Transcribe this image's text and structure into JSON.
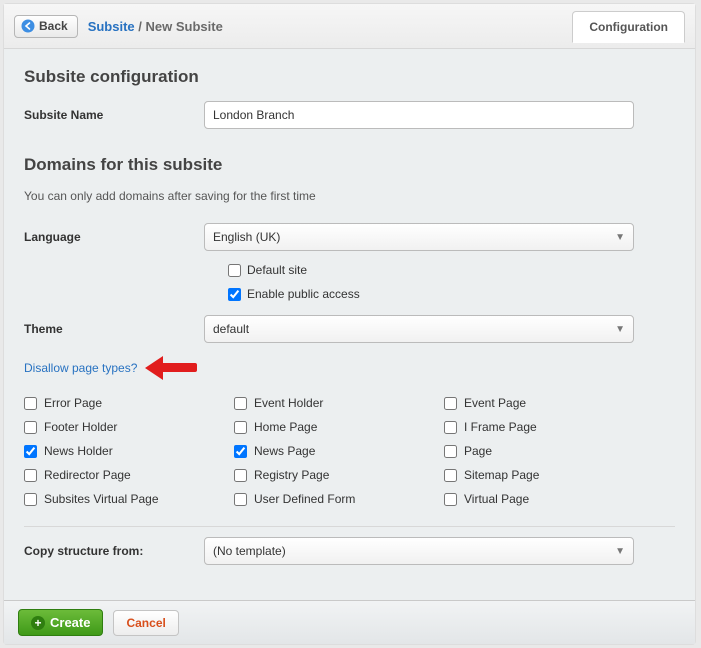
{
  "header": {
    "back_label": "Back",
    "breadcrumb_link": "Subsite",
    "breadcrumb_current": "New Subsite",
    "tab_label": "Configuration"
  },
  "section_config": {
    "title": "Subsite configuration",
    "subsite_name_label": "Subsite Name",
    "subsite_name_value": "London Branch"
  },
  "section_domains": {
    "title": "Domains for this subsite",
    "note": "You can only add domains after saving for the first time",
    "language_label": "Language",
    "language_value": "English (UK)",
    "default_site_label": "Default site",
    "default_site_checked": false,
    "public_access_label": "Enable public access",
    "public_access_checked": true,
    "theme_label": "Theme",
    "theme_value": "default",
    "disallow_link": "Disallow page types?"
  },
  "page_types": [
    {
      "label": "Error Page",
      "checked": false
    },
    {
      "label": "Event Holder",
      "checked": false
    },
    {
      "label": "Event Page",
      "checked": false
    },
    {
      "label": "Footer Holder",
      "checked": false
    },
    {
      "label": "Home Page",
      "checked": false
    },
    {
      "label": "I Frame Page",
      "checked": false
    },
    {
      "label": "News Holder",
      "checked": true
    },
    {
      "label": "News Page",
      "checked": true
    },
    {
      "label": "Page",
      "checked": false
    },
    {
      "label": "Redirector Page",
      "checked": false
    },
    {
      "label": "Registry Page",
      "checked": false
    },
    {
      "label": "Sitemap Page",
      "checked": false
    },
    {
      "label": "Subsites Virtual Page",
      "checked": false
    },
    {
      "label": "User Defined Form",
      "checked": false
    },
    {
      "label": "Virtual Page",
      "checked": false
    }
  ],
  "copy_structure": {
    "label": "Copy structure from:",
    "value": "(No template)"
  },
  "footer": {
    "create_label": "Create",
    "cancel_label": "Cancel"
  }
}
